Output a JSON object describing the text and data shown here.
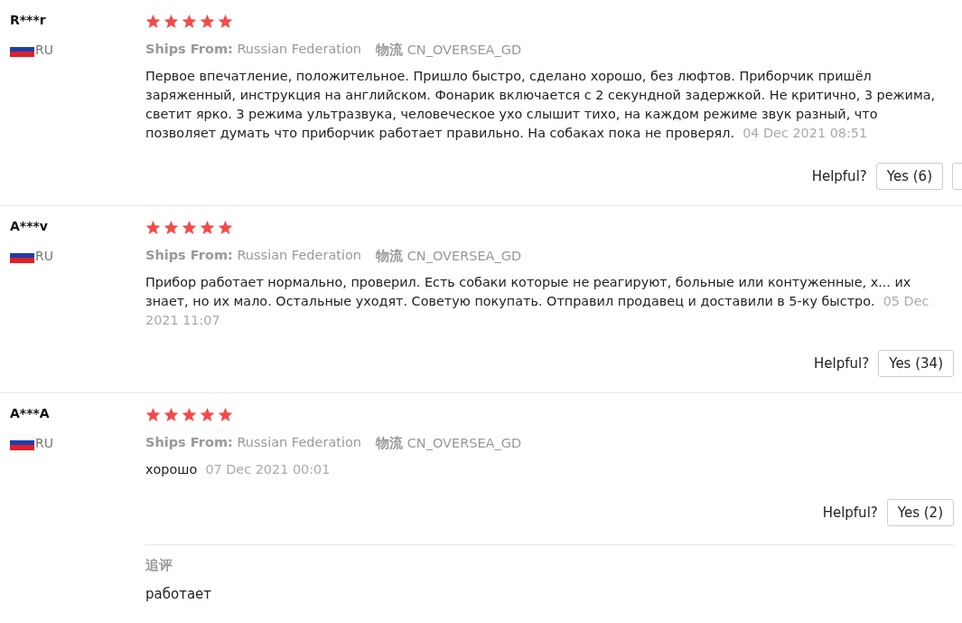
{
  "reviews": [
    {
      "user": "R***r",
      "country": "RU",
      "stars": 5,
      "ships_label": "Ships From:",
      "ships_from": "Russian Federation",
      "logistics_label": "物流",
      "logistics": "CN_OVERSEA_GD",
      "text": "Первое впечатление, положительное. Пришло быстро, сделано хорошо, без люфтов. Приборчик пришёл заряженный, инструкция на английском. Фонарик включается с 2 секундной задержкой. Не критично, 3 режима, светит ярко. 3 режима ультразвука, человеческое ухо слышит тихо, на каждом режиме звук разный, что позволяет думать что приборчик работает правильно. На собаках пока не проверял.",
      "date": "04 Dec 2021 08:51",
      "helpful_label": "Helpful?",
      "yes_button": "Yes (6)",
      "second_button_cut": true
    },
    {
      "user": "A***v",
      "country": "RU",
      "stars": 5,
      "ships_label": "Ships From:",
      "ships_from": "Russian Federation",
      "logistics_label": "物流",
      "logistics": "CN_OVERSEA_GD",
      "text": "Прибор работает нормально, проверил. Есть собаки которые не реагируют, больные или контуженные, х... их знает, но их мало. Остальные уходят. Советую покупать. Отправил продавец и доставили в 5-ку быстро.",
      "date": "05 Dec 2021 11:07",
      "helpful_label": "Helpful?",
      "yes_button": "Yes (34)",
      "second_button_cut": false
    },
    {
      "user": "A***A",
      "country": "RU",
      "stars": 5,
      "ships_label": "Ships From:",
      "ships_from": "Russian Federation",
      "logistics_label": "物流",
      "logistics": "CN_OVERSEA_GD",
      "text": "хорошо",
      "date": "07 Dec 2021 00:01",
      "helpful_label": "Helpful?",
      "yes_button": "Yes (2)",
      "second_button_cut": false,
      "follow_up": {
        "label": "追评",
        "text": "работает"
      }
    }
  ]
}
